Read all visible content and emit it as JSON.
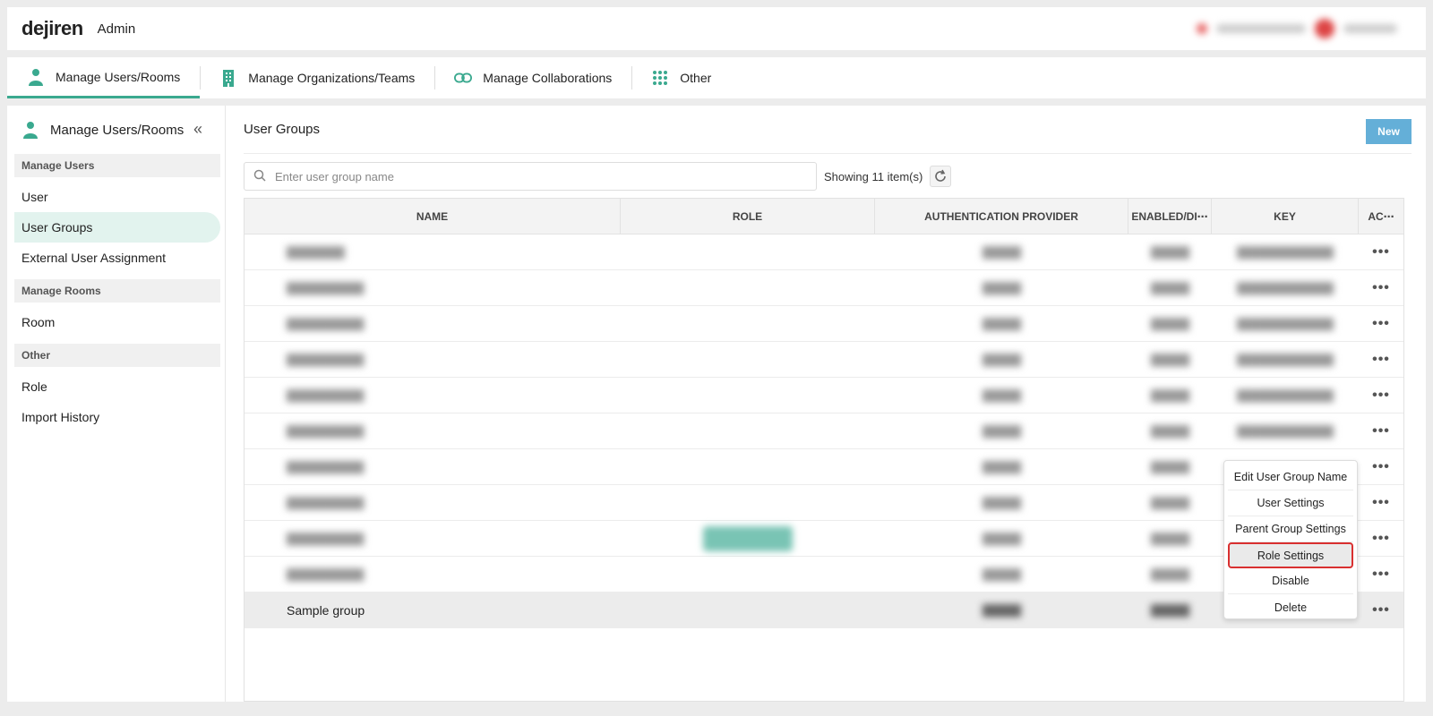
{
  "header": {
    "logo": "dejiren",
    "app_label": "Admin"
  },
  "nav_tabs": [
    {
      "label": "Manage Users/Rooms",
      "icon": "user-icon",
      "active": true
    },
    {
      "label": "Manage Organizations/Teams",
      "icon": "building-icon",
      "active": false
    },
    {
      "label": "Manage Collaborations",
      "icon": "link-icon",
      "active": false
    },
    {
      "label": "Other",
      "icon": "grid-icon",
      "active": false
    }
  ],
  "sidebar": {
    "title": "Manage Users/Rooms",
    "sections": [
      {
        "label": "Manage Users",
        "items": [
          "User",
          "User Groups",
          "External User Assignment"
        ]
      },
      {
        "label": "Manage Rooms",
        "items": [
          "Room"
        ]
      },
      {
        "label": "Other",
        "items": [
          "Role",
          "Import History"
        ]
      }
    ],
    "active_item": "User Groups"
  },
  "main": {
    "title": "User Groups",
    "new_button": "New",
    "search": {
      "placeholder": "Enter user group name",
      "value": ""
    },
    "count_text": "Showing 11 item(s)"
  },
  "table": {
    "columns": [
      "NAME",
      "ROLE",
      "AUTHENTICATION PROVIDER",
      "ENABLED/DI⋯",
      "KEY",
      "AC⋯"
    ],
    "last_row_name": "Sample group",
    "more_glyph": "•••"
  },
  "context_menu": {
    "items": [
      "Edit User Group Name",
      "User Settings",
      "Parent Group Settings",
      "Role Settings",
      "Disable",
      "Delete"
    ],
    "highlighted": "Role Settings"
  },
  "colors": {
    "accent": "#3aa98f",
    "new_button": "#64afd8",
    "highlight_border": "#d93030"
  }
}
